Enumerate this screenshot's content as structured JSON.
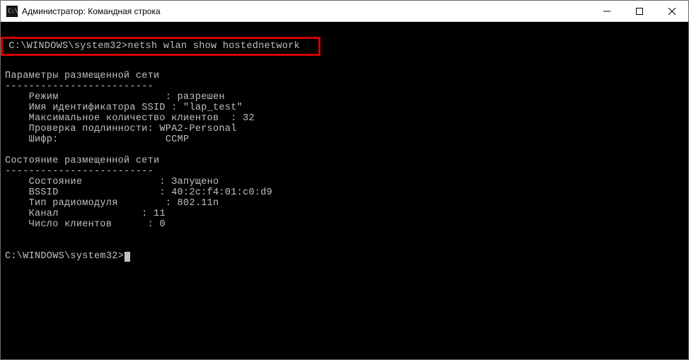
{
  "window": {
    "title": "Администратор: Командная строка"
  },
  "terminal": {
    "prompt1": "C:\\WINDOWS\\system32>",
    "command": "netsh wlan show hostednetwork",
    "section1_header": "Параметры размещенной сети",
    "divider": "-------------------------",
    "params": {
      "mode_label": "    Режим                  : ",
      "mode_value": "разрешен",
      "ssid_label": "    Имя идентификатора SSID : ",
      "ssid_value": "\"lap_test\"",
      "maxclients_label": "    Максимальное количество клиентов  : ",
      "maxclients_value": "32",
      "auth_label": "    Проверка подлинности: ",
      "auth_value": "WPA2-Personal",
      "cipher_label": "    Шифр:                  ",
      "cipher_value": "CCMP"
    },
    "section2_header": "Состояние размещенной сети",
    "state": {
      "status_label": "    Состояние             : ",
      "status_value": "Запущено",
      "bssid_label": "    BSSID                 : ",
      "bssid_value": "40:2c:f4:01:c0:d9",
      "radio_label": "    Тип радиомодуля        : ",
      "radio_value": "802.11n",
      "channel_label": "    Канал              : ",
      "channel_value": "11",
      "clients_label": "    Число клиентов      : ",
      "clients_value": "0"
    },
    "prompt2": "C:\\WINDOWS\\system32>"
  }
}
